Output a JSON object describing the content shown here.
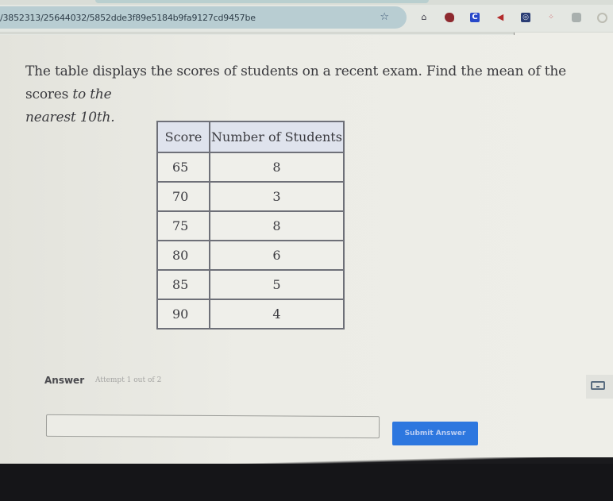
{
  "browser": {
    "url": "/3852313/25644032/5852dde3f89e5184b9fa9127cd9457be",
    "bookmark_icon": "star-icon",
    "extensions": [
      {
        "name": "home-lock-icon",
        "glyph": "⌂"
      },
      {
        "name": "red-extension-icon",
        "glyph": ""
      },
      {
        "name": "c-extension-icon",
        "glyph": "C"
      },
      {
        "name": "megaphone-icon",
        "glyph": "◀"
      },
      {
        "name": "compass-extension-icon",
        "glyph": "◎"
      },
      {
        "name": "dots-extension-icon",
        "glyph": "⁘"
      },
      {
        "name": "gray-extension-icon",
        "glyph": ""
      },
      {
        "name": "profile-circle-icon",
        "glyph": ""
      }
    ]
  },
  "question": {
    "text_main": "The table displays the scores of students on a recent exam. Find the mean of the scores ",
    "text_italic_1": "to the",
    "text_italic_2": "nearest 10th."
  },
  "table": {
    "headers": [
      "Score",
      "Number of Students"
    ],
    "rows": [
      [
        "65",
        "8"
      ],
      [
        "70",
        "3"
      ],
      [
        "75",
        "8"
      ],
      [
        "80",
        "6"
      ],
      [
        "85",
        "5"
      ],
      [
        "90",
        "4"
      ]
    ]
  },
  "answer": {
    "label": "Answer",
    "attempt": "Attempt 1 out of 2",
    "input_value": "",
    "submit_label": "Submit Answer",
    "keyboard_icon": "keyboard-icon"
  },
  "colors": {
    "submit_bg": "#2d77df",
    "table_header_bg": "#dfe3ed",
    "url_bar_bg": "#b8cdd2"
  }
}
